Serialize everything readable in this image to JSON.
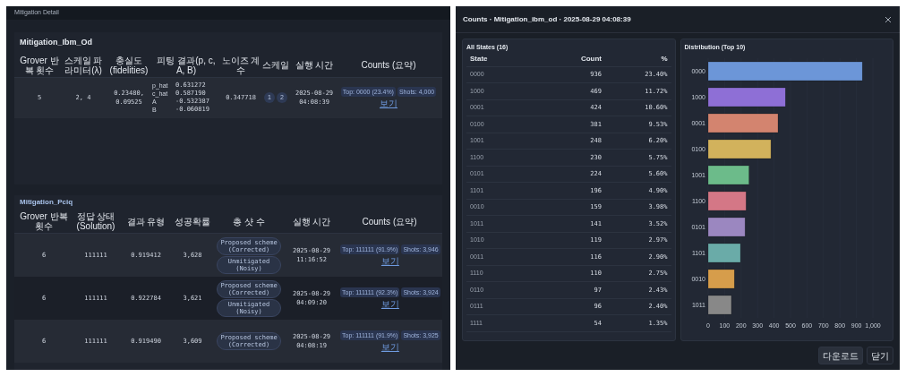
{
  "detail_window": {
    "title": "Mitigation Detail",
    "ibm_section": {
      "title": "Mitigation_Ibm_Od",
      "columns": [
        "Grover 반복 횟수",
        "스케일 파라미터(λ)",
        "충실도 (fidelities)",
        "피팅 결과(p, c, A, B)",
        "노이즈 계수",
        "스케일",
        "실행 시간",
        "Counts (요약)"
      ],
      "rows": [
        {
          "grover": "5",
          "scale_params": "2, 4",
          "fidelities": "0.23480, 0.09525",
          "fit": [
            {
              "name": "p_hat",
              "value": "0.631272"
            },
            {
              "name": "c_hat",
              "value": "0.587190"
            },
            {
              "name": "A",
              "value": "-0.532387"
            },
            {
              "name": "B",
              "value": "-0.060819"
            }
          ],
          "noise": "0.347718",
          "scales": [
            "1",
            "2"
          ],
          "time": "2025-08-29 04:08:39",
          "top": "Top: 0000 (23.4%)",
          "shots": "Shots: 4,000",
          "link": "보기"
        }
      ]
    },
    "pciq_section": {
      "title": "Mitigation_Pciq",
      "columns": [
        "Grover 반복 횟수",
        "정답 상태 (Solution)",
        "결과 유형",
        "성공확률",
        "총 샷 수",
        "실행 시간",
        "Counts (요약)"
      ],
      "rows": [
        {
          "grover": "6",
          "solution": "111111",
          "value": "0.919412",
          "count": "3,628",
          "badges": [
            "Proposed scheme (Corrected)",
            "Unmitigated (Noisy)"
          ],
          "time": "2025-08-29 11:16:52",
          "top": "Top: 111111 (91.9%)",
          "shots": "Shots: 3,946",
          "link": "보기"
        },
        {
          "grover": "6",
          "solution": "111111",
          "value": "0.922784",
          "count": "3,621",
          "badges": [
            "Proposed scheme (Corrected)",
            "Unmitigated (Noisy)"
          ],
          "time": "2025-08-29 04:09:20",
          "top": "Top: 111111 (92.3%)",
          "shots": "Shots: 3,924",
          "link": "보기"
        },
        {
          "grover": "6",
          "solution": "111111",
          "value": "0.919490",
          "count": "3,609",
          "badges": [
            "Proposed scheme (Corrected)"
          ],
          "time": "2025-08-29 04:08:19",
          "top": "Top: 111111 (91.9%)",
          "shots": "Shots: 3,925",
          "link": "보기"
        }
      ]
    }
  },
  "counts_dialog": {
    "title": "Counts · Mitigation_ibm_od · 2025-08-29 04:08:39",
    "states_card": {
      "title": "All States (16)",
      "columns": [
        "State",
        "Count",
        "%"
      ],
      "rows": [
        {
          "state": "0000",
          "count": "936",
          "pct": "23.40%"
        },
        {
          "state": "1000",
          "count": "469",
          "pct": "11.72%"
        },
        {
          "state": "0001",
          "count": "424",
          "pct": "10.60%"
        },
        {
          "state": "0100",
          "count": "381",
          "pct": "9.53%"
        },
        {
          "state": "1001",
          "count": "248",
          "pct": "6.20%"
        },
        {
          "state": "1100",
          "count": "230",
          "pct": "5.75%"
        },
        {
          "state": "0101",
          "count": "224",
          "pct": "5.60%"
        },
        {
          "state": "1101",
          "count": "196",
          "pct": "4.90%"
        },
        {
          "state": "0010",
          "count": "159",
          "pct": "3.98%"
        },
        {
          "state": "1011",
          "count": "141",
          "pct": "3.52%"
        },
        {
          "state": "1010",
          "count": "119",
          "pct": "2.97%"
        },
        {
          "state": "0011",
          "count": "116",
          "pct": "2.90%"
        },
        {
          "state": "1110",
          "count": "110",
          "pct": "2.75%"
        },
        {
          "state": "0110",
          "count": "97",
          "pct": "2.43%"
        },
        {
          "state": "0111",
          "count": "96",
          "pct": "2.40%"
        },
        {
          "state": "1111",
          "count": "54",
          "pct": "1.35%"
        }
      ]
    },
    "chart_card": {
      "chart_data": {
        "type": "bar",
        "orientation": "horizontal",
        "title": "Distribution (Top 10)",
        "categories": [
          "0000",
          "1000",
          "0001",
          "0100",
          "1001",
          "1100",
          "0101",
          "1101",
          "0010",
          "1011"
        ],
        "colors": [
          "#6c96d8",
          "#8e6fd6",
          "#d3846f",
          "#d2b25c",
          "#6cbb8a",
          "#d47786",
          "#9b87c0",
          "#6aaba8",
          "#d69d4b",
          "#888888"
        ],
        "series": [
          {
            "values": [
              936,
              469,
              424,
              381,
              248,
              230,
              224,
              196,
              159,
              141
            ]
          }
        ],
        "xlim": [
          0,
          1000
        ],
        "xticks": [
          0,
          100,
          200,
          300,
          400,
          500,
          600,
          700,
          800,
          900,
          {
            "value": 1000,
            "label": "1,000"
          }
        ]
      }
    },
    "buttons": [
      "다운로드",
      "닫기"
    ]
  }
}
